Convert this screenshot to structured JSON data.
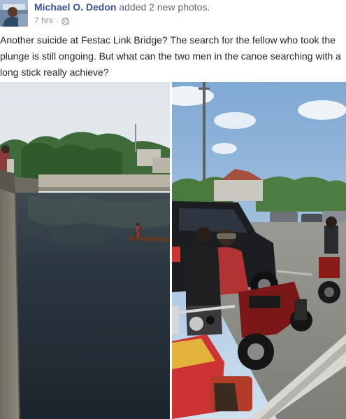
{
  "post": {
    "author": "Michael O. Dedon",
    "action": "added 2 new photos.",
    "timestamp": "7 hrs",
    "separator": "·",
    "privacy_icon": "globe-icon",
    "caption": "Another suicide at Festac Link Bridge? The search for the fellow who took the plunge is still ongoing. But what can the two men in the canoe searching with a long stick really achieve?"
  },
  "colors": {
    "author_link": "#365899",
    "meta_text": "#90949c",
    "body_text": "#1d2129"
  }
}
